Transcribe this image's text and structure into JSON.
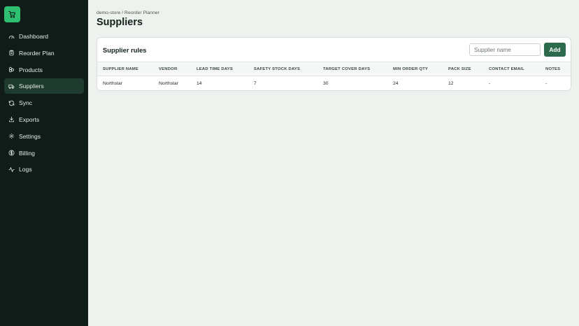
{
  "sidebar": {
    "logo_icon": "cart-icon",
    "items": [
      {
        "label": "Dashboard",
        "icon": "gauge-icon"
      },
      {
        "label": "Reorder Plan",
        "icon": "clipboard-icon"
      },
      {
        "label": "Products",
        "icon": "boxes-icon"
      },
      {
        "label": "Suppliers",
        "icon": "truck-icon",
        "active": true
      },
      {
        "label": "Sync",
        "icon": "refresh-icon"
      },
      {
        "label": "Exports",
        "icon": "download-icon"
      },
      {
        "label": "Settings",
        "icon": "gear-icon"
      },
      {
        "label": "Billing",
        "icon": "dollar-icon"
      },
      {
        "label": "Logs",
        "icon": "activity-icon"
      }
    ]
  },
  "header": {
    "breadcrumb": "demo-store / Reorder Planner",
    "title": "Suppliers"
  },
  "card": {
    "title": "Supplier rules",
    "search_placeholder": "Supplier name",
    "add_label": "Add"
  },
  "table": {
    "columns": [
      "SUPPLIER NAME",
      "VENDOR",
      "LEAD TIME DAYS",
      "SAFETY STOCK DAYS",
      "TARGET COVER DAYS",
      "MIN ORDER QTY",
      "PACK SIZE",
      "CONTACT EMAIL",
      "NOTES"
    ],
    "rows": [
      [
        "Northstar",
        "Northstar",
        "14",
        "7",
        "30",
        "24",
        "12",
        "-",
        "-"
      ]
    ]
  },
  "colors": {
    "sidebar_bg": "#0f1c17",
    "accent": "#2fbf71",
    "button": "#2d6a4c",
    "page_bg": "#eef2ee"
  }
}
